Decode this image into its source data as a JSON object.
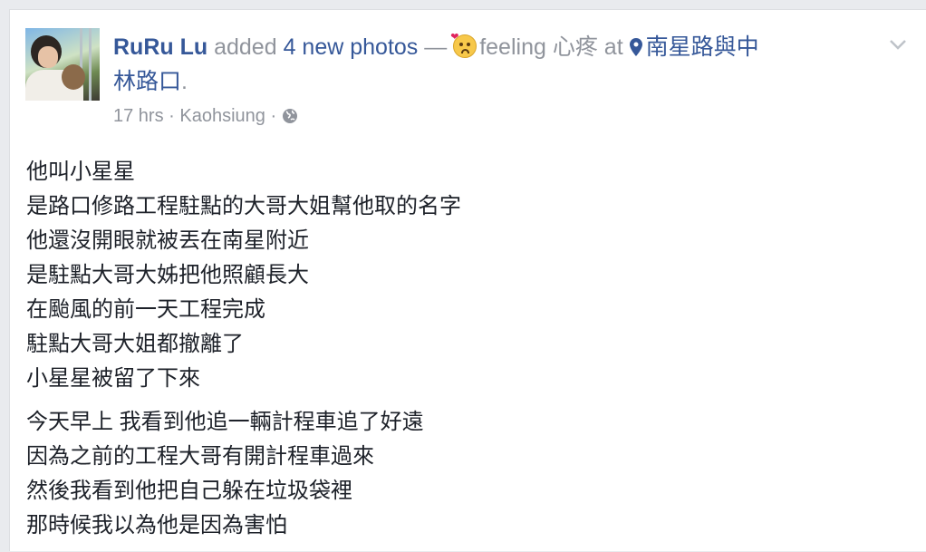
{
  "post": {
    "author": "RuRu Lu",
    "action": "added",
    "photos_link": "4 new photos",
    "dash": "—",
    "feeling_word": "feeling",
    "feeling": "心疼",
    "at": "at",
    "location_line1": "南星路與中",
    "location_line2": "林路口",
    "period": ".",
    "time": "17 hrs",
    "separator": "·",
    "place": "Kaohsiung",
    "separator2": "·",
    "icons": {
      "emoji": "worried-face-emoji-icon",
      "location": "map-pin-icon",
      "privacy": "globe-icon",
      "menu": "chevron-down-icon"
    },
    "colors": {
      "link": "#365899",
      "meta": "#90949c",
      "text": "#1d2129"
    },
    "paragraphs": [
      [
        "他叫小星星",
        "是路口修路工程駐點的大哥大姐幫他取的名字",
        "他還沒開眼就被丟在南星附近",
        "是駐點大哥大姊把他照顧長大",
        "在颱風的前一天工程完成",
        "駐點大哥大姐都撤離了",
        "小星星被留了下來"
      ],
      [
        "今天早上 我看到他追一輛計程車追了好遠",
        "因為之前的工程大哥有開計程車過來",
        "然後我看到他把自己躲在垃圾袋裡",
        "那時候我以為他是因為害怕"
      ]
    ]
  }
}
